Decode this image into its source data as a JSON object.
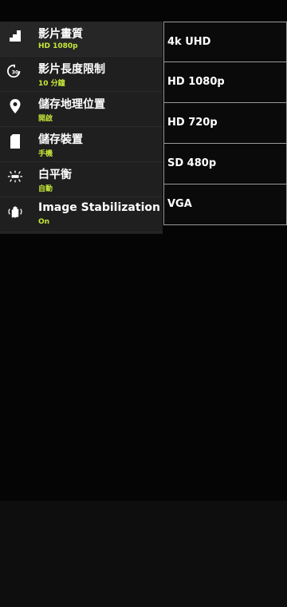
{
  "settings": {
    "items": [
      {
        "icon": "video-quality-icon",
        "title": "影片畫質",
        "value": "HD 1080p"
      },
      {
        "icon": "video-duration-timer-icon",
        "title": "影片長度限制",
        "value": "10 分鐘",
        "icon_text": "30"
      },
      {
        "icon": "location-pin-icon",
        "title": "儲存地理位置",
        "value": "開啟"
      },
      {
        "icon": "sd-card-icon",
        "title": "儲存裝置",
        "value": "手機"
      },
      {
        "icon": "white-balance-icon",
        "title": "白平衡",
        "value": "自動"
      },
      {
        "icon": "hand-stabilization-icon",
        "title": "Image Stabilization",
        "value": "On"
      }
    ]
  },
  "quality_options": [
    "4k UHD",
    "HD 1080p",
    "HD 720p",
    "SD 480p",
    "VGA"
  ],
  "colors": {
    "accent": "#c6e83a",
    "menu_background": "#1f1f1f",
    "option_border": "#9a9a9a"
  }
}
